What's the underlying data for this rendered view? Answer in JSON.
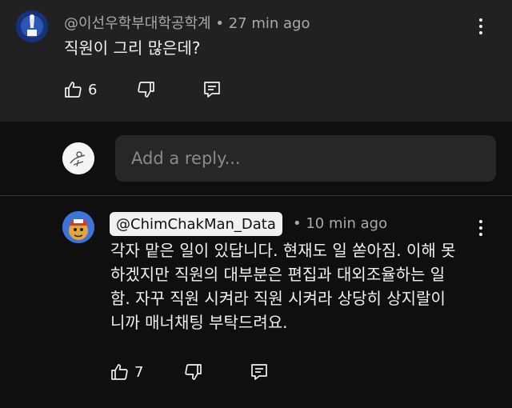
{
  "comment": {
    "author": "@이선우학부대학공학계",
    "separator": "•",
    "time": "27 min ago",
    "text": "직원이 그리 많은데?",
    "like_count": "6"
  },
  "reply_input": {
    "placeholder": "Add a reply..."
  },
  "reply": {
    "author": "@ChimChakMan_Data",
    "separator": "•",
    "time": "10 min ago",
    "lines": [
      "각자 맡은 일이 있답니다. 현재도 일 쏟아짐. 이해 못",
      "하겠지만 직원의 대부분은 편집과 대외조율하는 일",
      "함. 자꾸 직원 시켜라 직원 시켜라 상당히 상지랄이",
      "니까 매너채팅 부탁드려요."
    ],
    "like_count": "7"
  },
  "colors": {
    "comment_bg": "#212121",
    "page_bg": "#0f0f0f",
    "input_bg": "#272727",
    "muted_text": "#aaaaaa",
    "primary_text": "#f1f1f1",
    "author_chip_bg": "#f1f1f1"
  },
  "icons": {
    "like": "thumbs-up-icon",
    "dislike": "thumbs-down-icon",
    "reply": "comment-reply-icon",
    "more": "more-vertical-icon"
  }
}
